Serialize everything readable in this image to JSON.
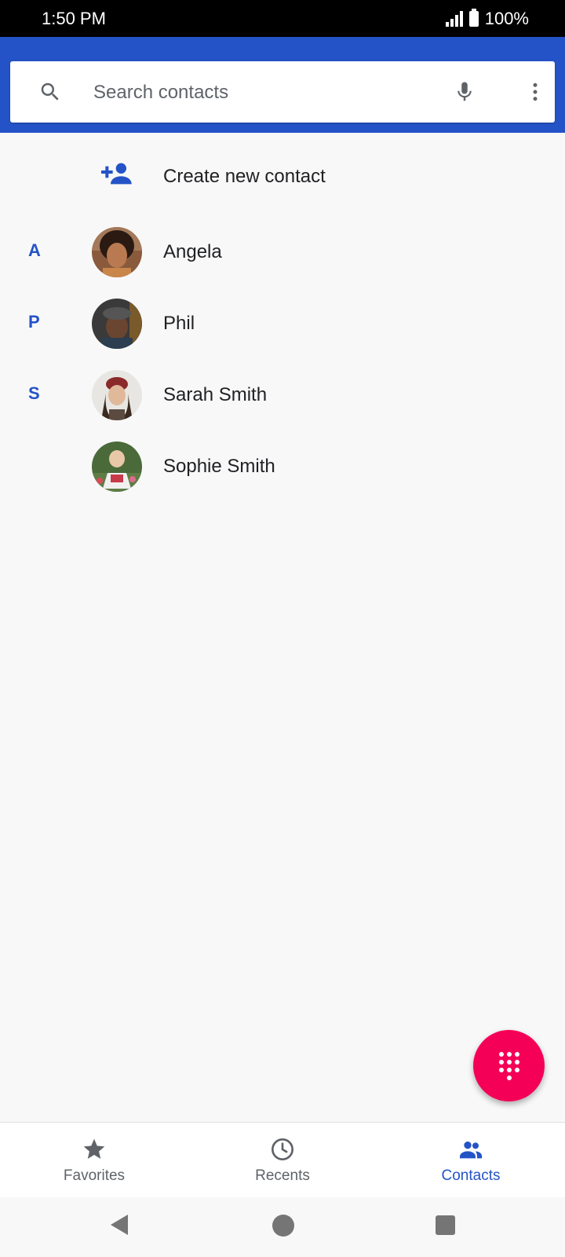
{
  "status_bar": {
    "time": "1:50 PM",
    "battery": "100%"
  },
  "search": {
    "placeholder": "Search contacts"
  },
  "create_contact": {
    "label": "Create new contact"
  },
  "contacts": [
    {
      "letter": "A",
      "name": "Angela"
    },
    {
      "letter": "P",
      "name": "Phil"
    },
    {
      "letter": "S",
      "name": "Sarah Smith"
    },
    {
      "letter": "",
      "name": "Sophie Smith"
    }
  ],
  "bottom_nav": [
    {
      "label": "Favorites",
      "icon": "star-icon",
      "active": false
    },
    {
      "label": "Recents",
      "icon": "clock-icon",
      "active": false
    },
    {
      "label": "Contacts",
      "icon": "contacts-icon",
      "active": true
    }
  ],
  "fab": {
    "icon": "dialpad-icon"
  },
  "colors": {
    "primary": "#2453c7",
    "fab": "#f50057",
    "background": "#f8f8f8"
  }
}
